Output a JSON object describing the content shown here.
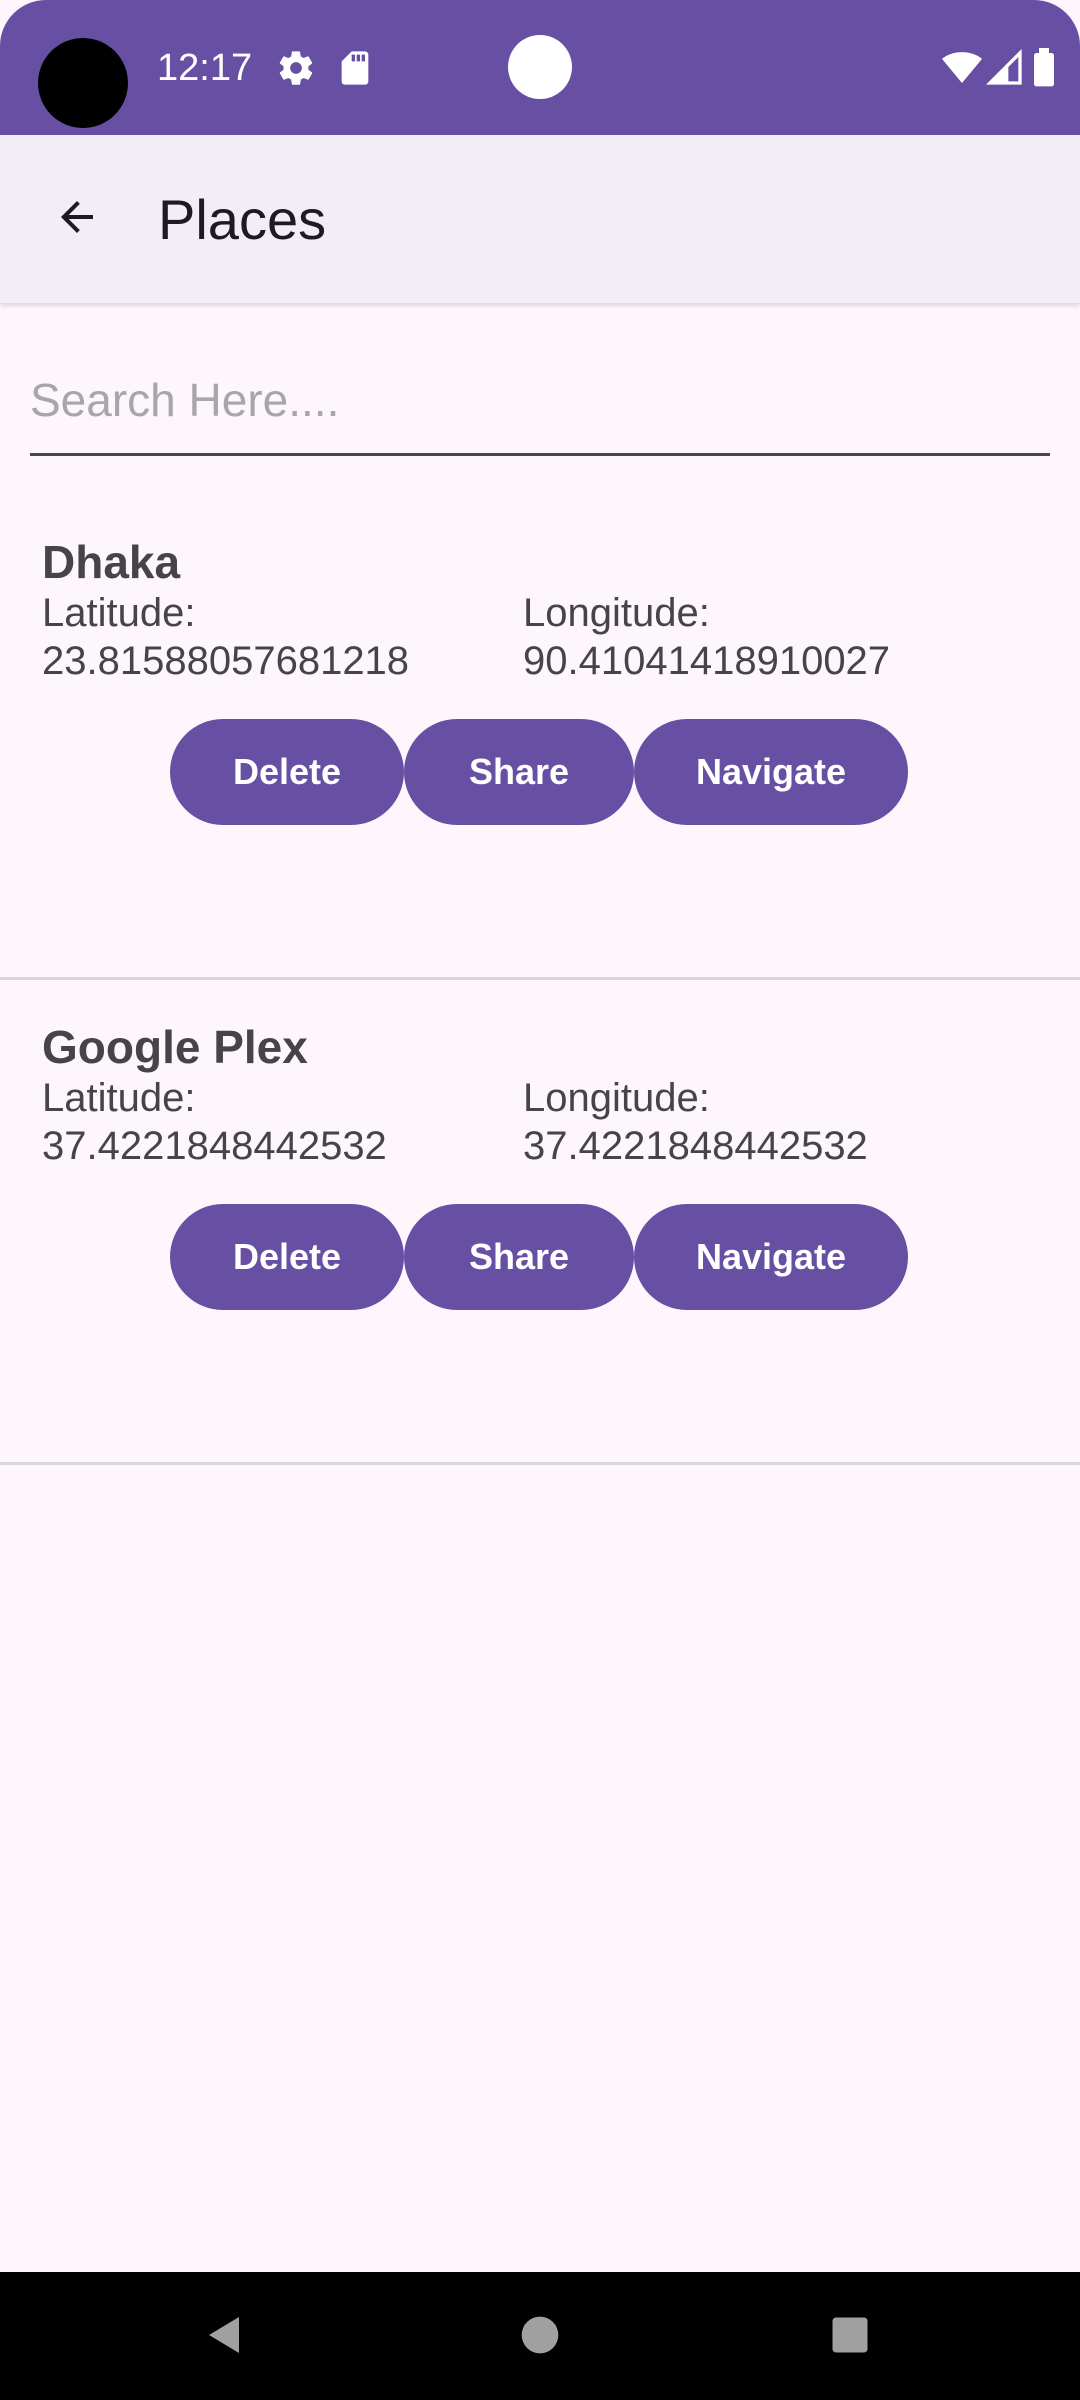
{
  "status_bar": {
    "time": "12:17",
    "icons": [
      "gear-icon",
      "sd-card-icon",
      "wifi-icon",
      "cell-signal-icon",
      "battery-icon"
    ],
    "background": "#6750a4"
  },
  "app_bar": {
    "title": "Places",
    "back_icon": "arrow-back-icon",
    "background": "#f2edf7"
  },
  "search": {
    "placeholder": "Search Here....",
    "value": ""
  },
  "places": [
    {
      "name": "Dhaka",
      "latitude_label": "Latitude:",
      "latitude": "23.81588057681218",
      "longitude_label": "Longitude:",
      "longitude": "90.41041418910027",
      "buttons": {
        "delete": "Delete",
        "share": "Share",
        "navigate": "Navigate"
      }
    },
    {
      "name": "Google Plex",
      "latitude_label": "Latitude:",
      "latitude": "37.4221848442532",
      "longitude_label": "Longitude:",
      "longitude": "37.4221848442532",
      "buttons": {
        "delete": "Delete",
        "share": "Share",
        "navigate": "Navigate"
      }
    }
  ],
  "nav_bar": {
    "icons": [
      "back-triangle-icon",
      "home-circle-icon",
      "recents-square-icon"
    ]
  },
  "colors": {
    "accent": "#6750a4",
    "text": "#46434b",
    "divider": "#dad6dc"
  }
}
